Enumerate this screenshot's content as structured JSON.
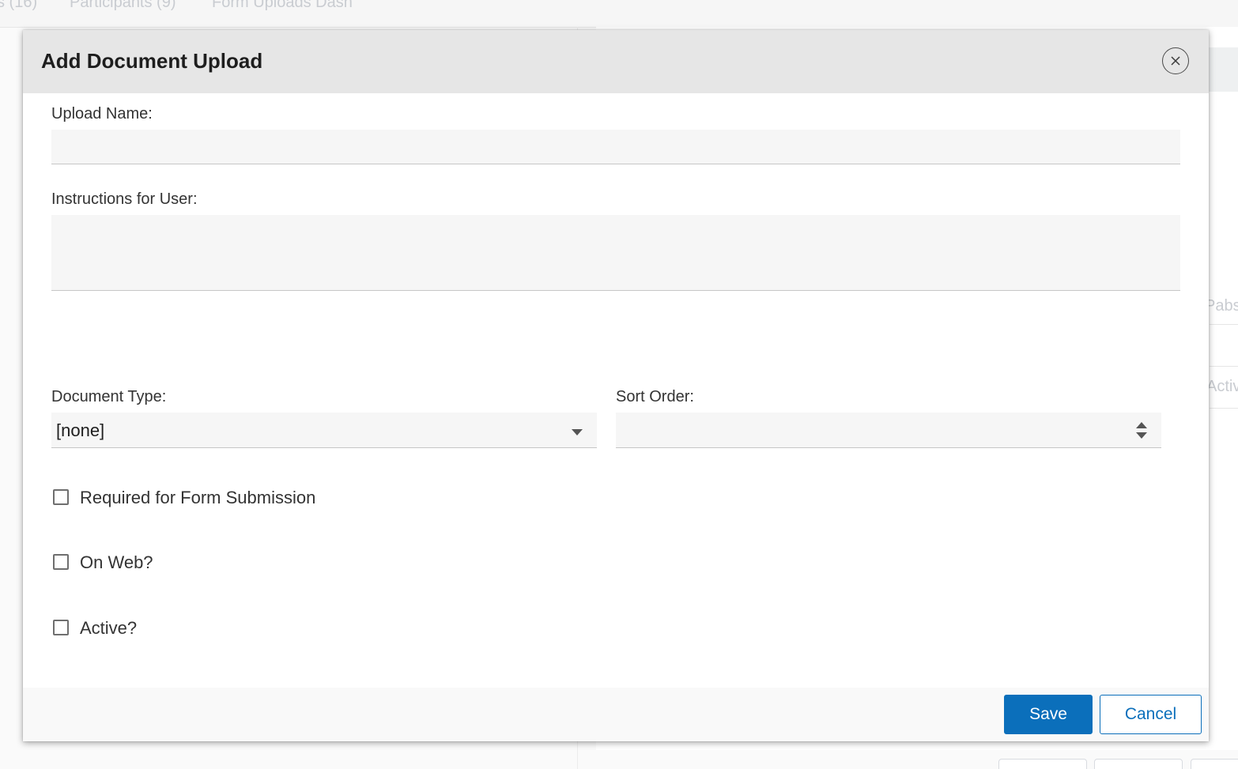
{
  "background": {
    "tabs": [
      "s (16)",
      "Participants (9)",
      "Form Uploads Dash"
    ],
    "fragments": [
      "Pabs",
      "Activ"
    ]
  },
  "modal": {
    "title": "Add Document Upload",
    "fields": {
      "upload_name": {
        "label": "Upload Name:",
        "value": ""
      },
      "instructions": {
        "label": "Instructions for User:",
        "value": ""
      },
      "document_type": {
        "label": "Document Type:",
        "value": "[none]"
      },
      "sort_order": {
        "label": "Sort Order:",
        "value": ""
      }
    },
    "checkboxes": {
      "required": {
        "label": "Required for Form Submission",
        "checked": false
      },
      "on_web": {
        "label": "On Web?",
        "checked": false
      },
      "active": {
        "label": "Active?",
        "checked": false
      }
    },
    "footer": {
      "save_label": "Save",
      "cancel_label": "Cancel"
    }
  },
  "colors": {
    "primary": "#0b6fbb",
    "header_bg": "#e6e6e6",
    "input_bg": "#f6f6f6"
  }
}
